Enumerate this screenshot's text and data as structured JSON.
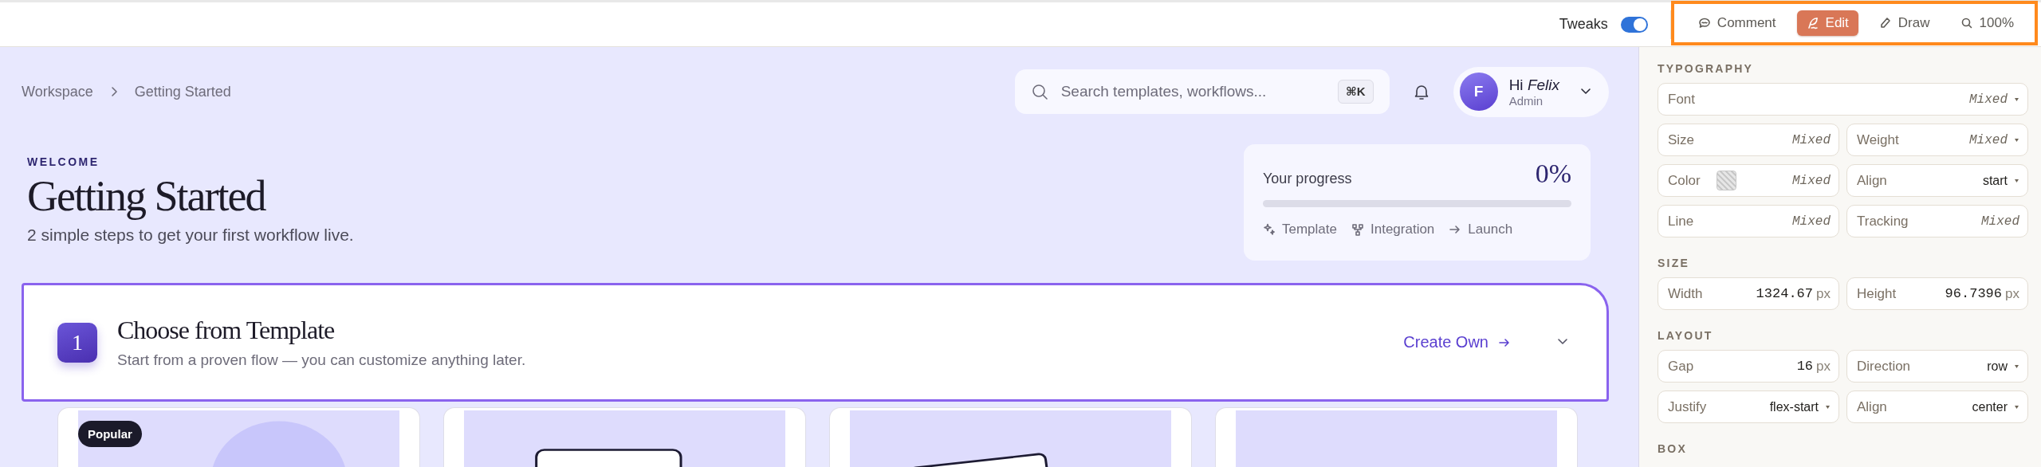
{
  "toolbar": {
    "tweaks": {
      "label": "Tweaks",
      "on": true
    },
    "tools": [
      {
        "label": "Comment",
        "selected": false
      },
      {
        "label": "Edit",
        "selected": true
      },
      {
        "label": "Draw",
        "selected": false
      },
      {
        "label": "100%",
        "selected": false
      }
    ]
  },
  "breadcrumb": [
    "Workspace",
    "Getting Started"
  ],
  "search": {
    "placeholder": "Search templates, workflows...",
    "shortcut": "⌘K"
  },
  "user": {
    "initial": "F",
    "greeting": "Hi *Felix*",
    "role": "Admin"
  },
  "header": {
    "eyebrow": "WELCOME",
    "title": "Getting Started",
    "subtitle": "2 simple steps to get your first workflow live."
  },
  "progress": {
    "label": "Your progress",
    "percent": "0%",
    "level": 0,
    "steps": [
      "Template",
      "Integration",
      "Launch"
    ]
  },
  "step": {
    "number": "1",
    "title": "Choose from Template",
    "subtitle": "Start from a proven flow — you can customize anything later.",
    "action": "Create Own",
    "expanded": true
  },
  "templates": [
    {
      "kind": "circle",
      "badge": "Popular"
    },
    {
      "kind": "frame"
    },
    {
      "kind": "tilted"
    },
    {
      "kind": "blank"
    }
  ],
  "inspector": [
    {
      "title": "TYPOGRAPHY",
      "fields": [
        {
          "label": "Font",
          "value": "Mixed",
          "mixed": true,
          "dropdown": true,
          "wide": true
        },
        {
          "label": "Size",
          "value": "Mixed",
          "mixed": true,
          "dropdown": false
        },
        {
          "label": "Weight",
          "value": "Mixed",
          "mixed": true,
          "dropdown": true
        },
        {
          "label": "Color",
          "value": "Mixed",
          "mixed": true,
          "dropdown": false,
          "swatch": true
        },
        {
          "label": "Align",
          "value": "start",
          "mixed": false,
          "dropdown": true
        },
        {
          "label": "Line",
          "value": "Mixed",
          "mixed": true,
          "dropdown": false
        },
        {
          "label": "Tracking",
          "value": "Mixed",
          "mixed": true,
          "dropdown": false
        }
      ]
    },
    {
      "title": "SIZE",
      "fields": [
        {
          "label": "Width",
          "value": "1324.67",
          "unit": "px",
          "mixed": false,
          "dropdown": false
        },
        {
          "label": "Height",
          "value": "96.7396",
          "unit": "px",
          "mixed": false,
          "dropdown": false
        }
      ]
    },
    {
      "title": "LAYOUT",
      "fields": [
        {
          "label": "Gap",
          "value": "16",
          "unit": "px",
          "mixed": false,
          "dropdown": false
        },
        {
          "label": "Direction",
          "value": "row",
          "mixed": false,
          "dropdown": true
        },
        {
          "label": "Justify",
          "value": "flex-start",
          "mixed": false,
          "dropdown": true
        },
        {
          "label": "Align",
          "value": "center",
          "mixed": false,
          "dropdown": true
        }
      ]
    },
    {
      "title": "BOX"
    }
  ]
}
